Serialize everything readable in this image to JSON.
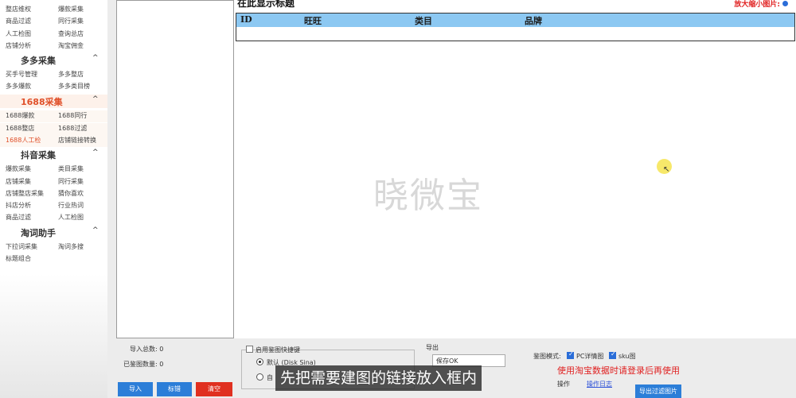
{
  "sidebar": {
    "rows_top": [
      {
        "c1": "整店维权",
        "c2": "爆款采集"
      },
      {
        "c1": "商品过滤",
        "c2": "同行采集"
      },
      {
        "c1": "人工检图",
        "c2": "查询总店"
      },
      {
        "c1": "店铺分析",
        "c2": "淘宝佣金"
      }
    ],
    "sections": [
      {
        "title": "多多采集",
        "rows": [
          {
            "c1": "买手号管理",
            "c2": "多多整店"
          },
          {
            "c1": "多多爆款",
            "c2": "多多类目榜"
          }
        ]
      },
      {
        "title": "1688采集",
        "rows": [
          {
            "c1": "1688爆款",
            "c2": "1688同行"
          },
          {
            "c1": "1688整店",
            "c2": "1688过滤"
          },
          {
            "c1": "1688人工检",
            "c2": "店铺链接转换"
          }
        ]
      },
      {
        "title": "抖音采集",
        "rows": [
          {
            "c1": "爆款采集",
            "c2": "类目采集"
          },
          {
            "c1": "店铺采集",
            "c2": "同行采集"
          },
          {
            "c1": "店铺整店采集",
            "c2": "猜你喜欢"
          },
          {
            "c1": "抖店分析",
            "c2": "行业热词"
          },
          {
            "c1": "商品过滤",
            "c2": "人工检图"
          }
        ]
      },
      {
        "title": "淘词助手",
        "rows": [
          {
            "c1": "下拉词采集",
            "c2": "淘词多搜"
          },
          {
            "c1": "标题组合",
            "c2": ""
          }
        ]
      }
    ],
    "chevron": "^"
  },
  "table": {
    "title": "在此显示标题",
    "zoom_label": "放大缩小图片:",
    "columns": [
      "ID",
      "旺旺",
      "类目",
      "品牌"
    ],
    "watermark": "晓微宝"
  },
  "bottom": {
    "import_total": "导入总数: 0",
    "checked_total": "已鉴图数量: 0",
    "quick_key_label": "启用鉴图快捷键",
    "radio_default": "默认 (Disk Sina)",
    "radio_other": "自",
    "export_label": "导出",
    "export_select": "保存OK",
    "mode_label": "鉴图模式:",
    "mode_pc": "PC详情图",
    "mode_sku": "sku图",
    "login_notice": "使用淘宝数据时请登录后再使用",
    "operate": "操作",
    "link_text": "操作日志",
    "btn_import": "导入",
    "btn_check": "标错",
    "btn_clear": "清空",
    "btn_export_filtered": "导出过滤图片"
  },
  "subtitle": "先把需要建图的链接放入框内"
}
